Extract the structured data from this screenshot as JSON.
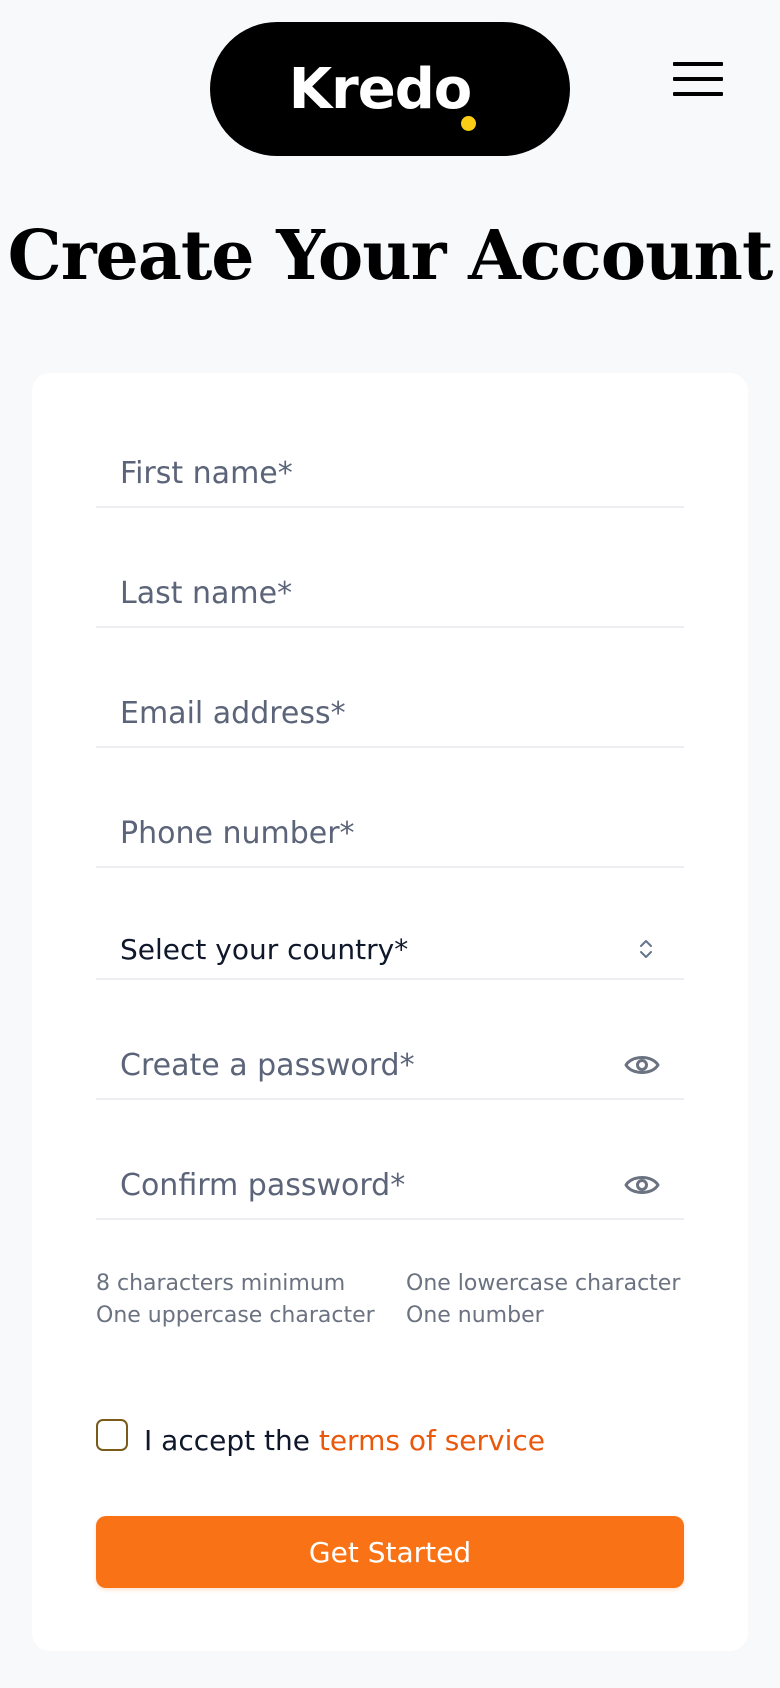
{
  "header": {
    "logo_text": "Kredo"
  },
  "page": {
    "title": "Create Your Account"
  },
  "form": {
    "first_name": {
      "placeholder": "First name*",
      "value": ""
    },
    "last_name": {
      "placeholder": "Last name*",
      "value": ""
    },
    "email": {
      "placeholder": "Email address*",
      "value": ""
    },
    "phone": {
      "placeholder": "Phone number*",
      "value": ""
    },
    "country": {
      "selected": "Select your country*"
    },
    "password": {
      "placeholder": "Create a password*",
      "value": ""
    },
    "confirm_password": {
      "placeholder": "Confirm password*",
      "value": ""
    },
    "password_rules": {
      "left": [
        "8 characters minimum",
        "One uppercase character"
      ],
      "right": [
        "One lowercase character",
        "One number"
      ]
    },
    "terms": {
      "prefix": "I accept the ",
      "link": "terms of service",
      "checked": false
    },
    "submit_label": "Get Started"
  },
  "colors": {
    "accent": "#f97316",
    "link": "#ea580c",
    "logo_dot": "#facc15",
    "logo_background": "#000000"
  },
  "icons": {
    "menu": "hamburger-icon",
    "select": "chevron-up-down-icon",
    "password_toggle": "eye-icon"
  }
}
